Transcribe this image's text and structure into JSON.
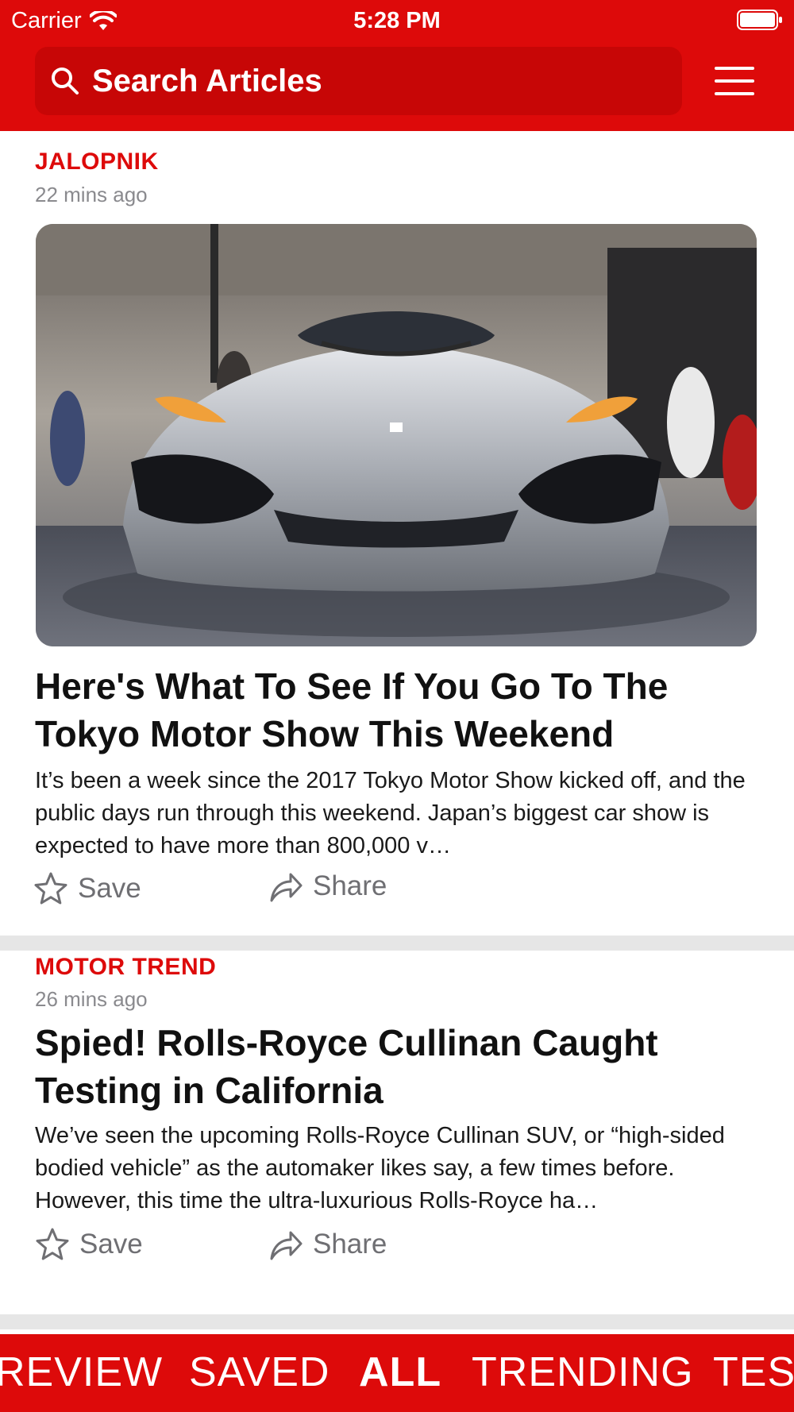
{
  "status_bar": {
    "carrier": "Carrier",
    "time": "5:28 PM"
  },
  "search": {
    "placeholder": "Search Articles"
  },
  "articles": [
    {
      "source": "JALOPNIK",
      "time_ago": "22 mins ago",
      "headline": "Here's What To See If You Go To The Tokyo Motor Show This Weekend",
      "summary": "It’s been a week since the 2017 Tokyo Motor Show kicked off, and the public days run through this weekend. Japan’s biggest car show is expected to have more than 800,000 v…",
      "save_label": "Save",
      "share_label": "Share"
    },
    {
      "source": "MOTOR TREND",
      "time_ago": "26 mins ago",
      "headline": "Spied! Rolls-Royce Cullinan Caught Testing in California",
      "summary": "We’ve seen the upcoming Rolls-Royce Cullinan SUV, or “high-sided bodied vehicle” as the automaker likes say, a few times before. However, this time the ultra-luxurious Rolls-Royce ha…",
      "save_label": "Save",
      "share_label": "Share"
    }
  ],
  "tabs": [
    {
      "label": "REVIEW",
      "active": false
    },
    {
      "label": "SAVED",
      "active": false
    },
    {
      "label": "ALL",
      "active": true
    },
    {
      "label": "TRENDING",
      "active": false
    },
    {
      "label": "TES",
      "active": false
    }
  ],
  "colors": {
    "brand": "#dd0a0a",
    "search_bg": "#c70606",
    "muted": "#8a8a8e"
  },
  "icons": [
    "wifi-icon",
    "battery-icon",
    "search-icon",
    "hamburger-menu-icon",
    "star-icon",
    "share-arrow-icon"
  ]
}
